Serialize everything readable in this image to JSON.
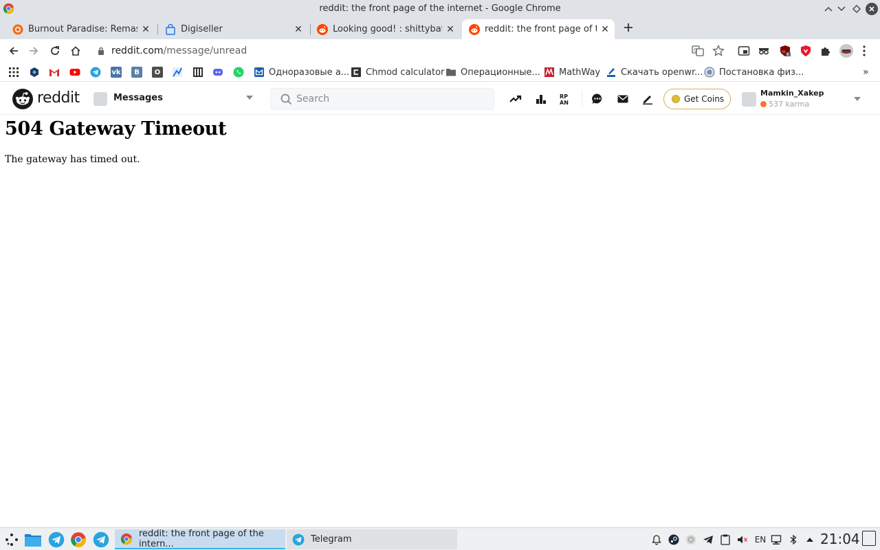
{
  "window": {
    "title": "reddit: the front page of the internet - Google Chrome",
    "controls": [
      "minimize",
      "restore",
      "maximize",
      "close"
    ]
  },
  "tabs": [
    {
      "label": "Burnout Paradise: Remastered",
      "icon": "ea-icon",
      "active": false
    },
    {
      "label": "Digiseller",
      "icon": "shopping-bag-icon",
      "active": false
    },
    {
      "label": "Looking good! : shittybattlestations",
      "icon": "reddit-icon",
      "active": false
    },
    {
      "label": "reddit: the front page of the internet",
      "icon": "reddit-icon",
      "active": true
    }
  ],
  "toolbar": {
    "url_host": "reddit.com",
    "url_path": "/message/unread"
  },
  "bookmarks": [
    {
      "label": "",
      "icon": "apps-grid-icon"
    },
    {
      "label": "",
      "icon": "codepen-icon"
    },
    {
      "label": "",
      "icon": "gmail-icon"
    },
    {
      "label": "",
      "icon": "youtube-icon"
    },
    {
      "label": "",
      "icon": "telegram-icon"
    },
    {
      "label": "",
      "icon": "vk-icon"
    },
    {
      "label": "",
      "icon": "vk-b-icon"
    },
    {
      "label": "",
      "icon": "odnoklassniki-icon"
    },
    {
      "label": "",
      "icon": "chart-icon"
    },
    {
      "label": "",
      "icon": "library-icon"
    },
    {
      "label": "",
      "icon": "discord-icon"
    },
    {
      "label": "",
      "icon": "whatsapp-icon"
    },
    {
      "label": "Одноразовые а...",
      "icon": "mail-icon"
    },
    {
      "label": "Chmod calculator",
      "icon": "chmod-icon"
    },
    {
      "label": "Операционные...",
      "icon": "folder-icon"
    },
    {
      "label": "MathWay",
      "icon": "mathway-icon"
    },
    {
      "label": "Скачать openwr...",
      "icon": "openwrt-icon"
    },
    {
      "label": "Постановка физ...",
      "icon": "globe-icon"
    }
  ],
  "reddit": {
    "wordmark": "reddit",
    "community": "Messages",
    "search_placeholder": "Search",
    "get_coins": "Get Coins",
    "username": "Mamkin_Xakep",
    "karma": "537 karma"
  },
  "page": {
    "heading": "504 Gateway Timeout",
    "message": "The gateway has timed out."
  },
  "taskbar": {
    "tasks": [
      {
        "label": "reddit: the front page of the intern...",
        "icon": "chrome-icon",
        "active": true
      },
      {
        "label": "Telegram",
        "icon": "telegram-icon",
        "active": false
      }
    ],
    "language": "EN",
    "clock": "21:04"
  },
  "colors": {
    "reddit_orange": "#ff4500",
    "chrome_frame": "#dfe3e8",
    "taskbar_active": "#c9dcef"
  }
}
